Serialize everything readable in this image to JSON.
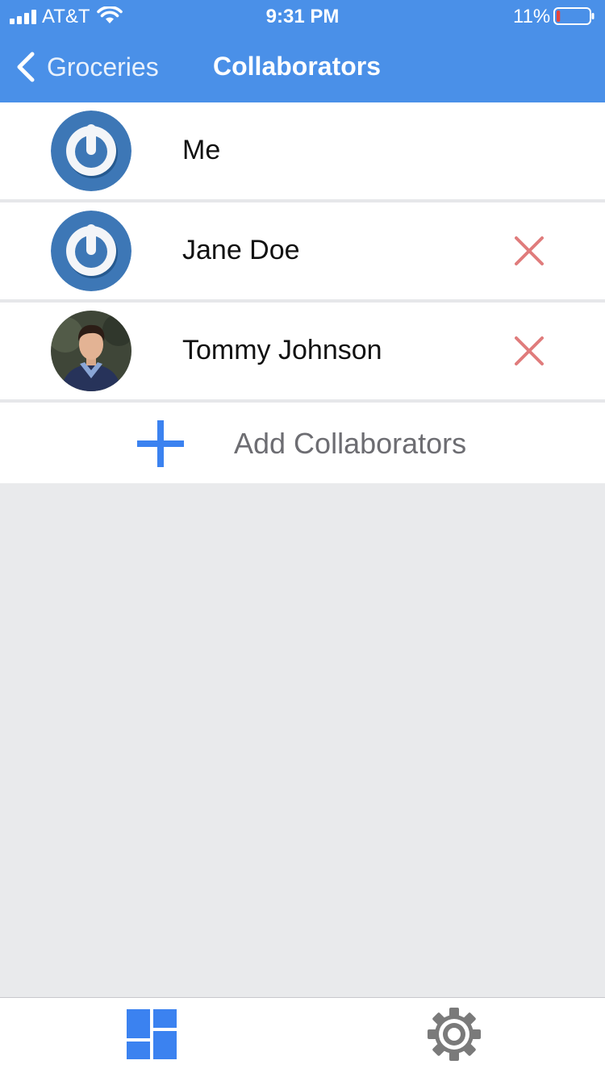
{
  "status_bar": {
    "carrier": "AT&T",
    "time": "9:31 PM",
    "battery_percent": "11%",
    "battery_level": 0.11,
    "icons": [
      "signal-icon",
      "wifi-icon",
      "battery-icon"
    ]
  },
  "nav": {
    "back_label": "Groceries",
    "title": "Collaborators"
  },
  "collaborators": [
    {
      "name": "Me",
      "avatar": "power-logo-avatar",
      "removable": false
    },
    {
      "name": "Jane Doe",
      "avatar": "power-logo-avatar",
      "removable": true
    },
    {
      "name": "Tommy Johnson",
      "avatar": "photo-avatar",
      "removable": true
    }
  ],
  "add": {
    "label": "Add Collaborators",
    "icon": "plus-icon"
  },
  "tabs": [
    {
      "icon": "dashboard-icon",
      "active": true
    },
    {
      "icon": "gear-icon",
      "active": false
    }
  ],
  "colors": {
    "header": "#4a90e8",
    "accent": "#3b82f0",
    "remove": "#e07c7c",
    "background": "#e9eaec",
    "inactive_tab": "#7a7a7a"
  }
}
